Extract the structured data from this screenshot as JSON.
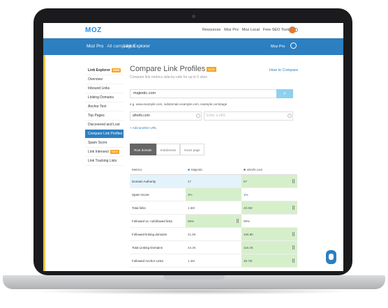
{
  "app": {
    "logo": "MOZ"
  },
  "topnav": [
    "Resources",
    "Moz Pro",
    "Moz Local",
    "Free SEO Tools"
  ],
  "bluebar": {
    "section": "Moz Pro",
    "campaigns": "All campaigns",
    "tool": "Link Explorer",
    "account": "Moz Pro"
  },
  "sidebar": {
    "items": [
      {
        "label": "Link Explorer",
        "badge": "NEW",
        "head": true
      },
      {
        "label": "Overview"
      },
      {
        "label": "Inbound Links"
      },
      {
        "label": "Linking Domains"
      },
      {
        "label": "Anchor Text"
      },
      {
        "label": "Top Pages"
      },
      {
        "label": "Discovered and Lost"
      },
      {
        "label": "Compare Link Profiles",
        "active": true
      },
      {
        "label": "Spam Score"
      },
      {
        "label": "Link Intersect",
        "badge": "NEW"
      },
      {
        "label": "Link Tracking Lists"
      }
    ]
  },
  "main": {
    "title": "Compare Link Profiles",
    "title_badge": "NEW",
    "subtitle": "Compare link metrics side-by-side for up to 5 sites",
    "howto": "How to Compare",
    "url_value": "majestic.com",
    "url_caption": "e.g. www.example.com, subdomain.example.com, example.com/page",
    "compare_one": "ahrefs.com",
    "compare_two_placeholder": "Enter a URL",
    "add_url": "+ Add another URL",
    "tabs": [
      "Root domain",
      "Subdomain",
      "Exact page"
    ]
  },
  "table": {
    "headers": [
      "Metrics",
      "Majestic",
      "ahrefs.com"
    ],
    "rows": [
      {
        "metric": "Domain Authority",
        "a": "47",
        "b": "67"
      },
      {
        "metric": "Spam Score",
        "a": "3%",
        "b": "1%"
      },
      {
        "metric": "Total links",
        "a": "1.6M",
        "b": "40.6M"
      },
      {
        "metric": "Followed vs. nofollowed links",
        "a": "96%",
        "b": "99%"
      },
      {
        "metric": "Followed linking domains",
        "a": "41.5K",
        "b": "106.8K"
      },
      {
        "metric": "Total Linking Domains",
        "a": "44.2K",
        "b": "116.4K"
      },
      {
        "metric": "Followed Anchor Links",
        "a": "1.4M",
        "b": "39.7M"
      }
    ]
  },
  "colors": {
    "accent": "#2c7fc0",
    "badge": "#f5a623",
    "win": "#d6efcb",
    "highlight": "#e4f3fb",
    "series_a": "#5aa9e6",
    "series_b": "#888888"
  }
}
